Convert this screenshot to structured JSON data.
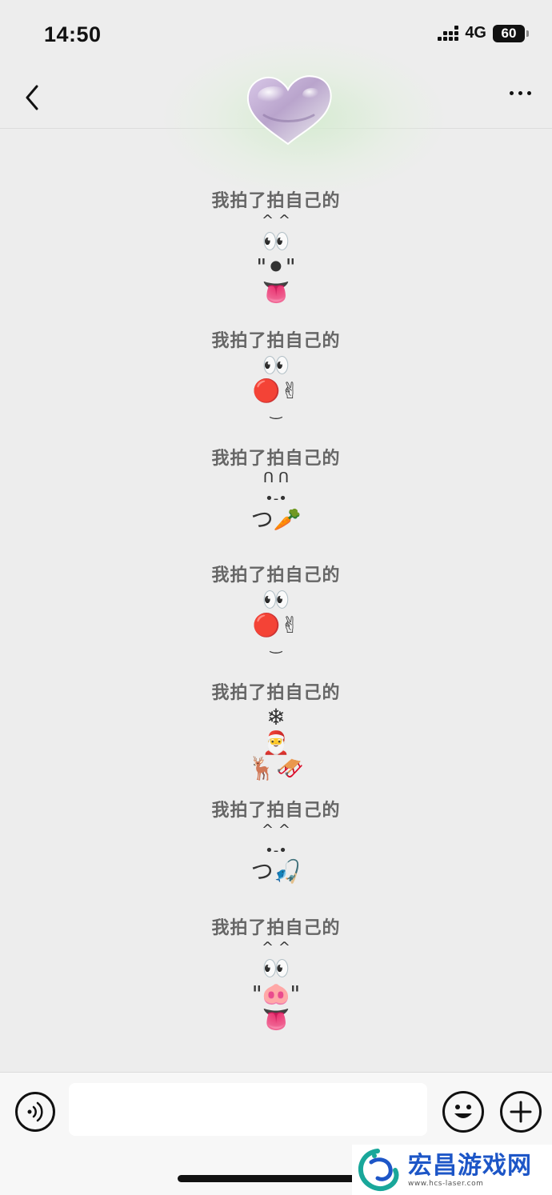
{
  "status_bar": {
    "time": "14:50",
    "network": "4G",
    "battery": "60"
  },
  "nav": {
    "back_icon": "chevron-left-icon",
    "more_icon": "more-dots-icon",
    "avatar": "heart-avatar"
  },
  "messages": [
    {
      "text": "我拍了拍自己的",
      "art": [
        "^ ^",
        "👀",
        "\"⚫\"",
        "👅"
      ]
    },
    {
      "text": "我拍了拍自己的",
      "art": [
        "👀",
        "🔴✌",
        "‿"
      ]
    },
    {
      "text": "我拍了拍自己的",
      "art": [
        "ᑎ ᑎ",
        "•-•",
        "つ🥕"
      ]
    },
    {
      "text": "我拍了拍自己的",
      "art": [
        "👀",
        "🔴✌",
        "‿"
      ]
    },
    {
      "text": "我拍了拍自己的",
      "art": [
        "❄",
        "🎅",
        "🦌🛷"
      ]
    },
    {
      "text": "我拍了拍自己的",
      "art": [
        "^ ^",
        "•-•",
        "つ🎣"
      ]
    },
    {
      "text": "我拍了拍自己的",
      "art": [
        "^ ^",
        "👀",
        "\"🐽\"",
        "👅"
      ]
    }
  ],
  "input_bar": {
    "placeholder": "",
    "voice_icon": "voice-icon",
    "emoji_icon": "emoji-icon",
    "plus_icon": "plus-icon"
  },
  "watermark": {
    "title": "宏昌游戏网",
    "url": "www.hcs-laser.com"
  }
}
